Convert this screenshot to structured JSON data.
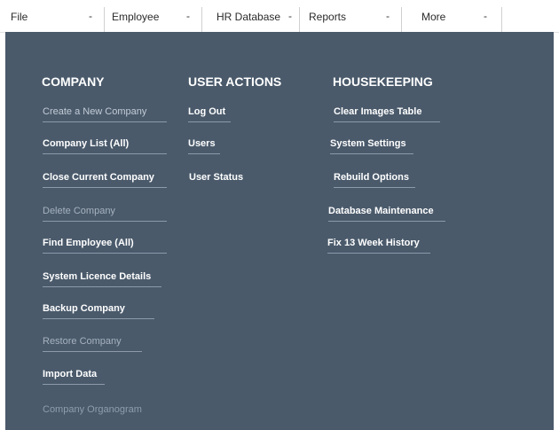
{
  "menubar": {
    "items": [
      {
        "label": "File"
      },
      {
        "label": "Employee"
      },
      {
        "label": "HR Database"
      },
      {
        "label": "Reports"
      },
      {
        "label": "More"
      }
    ],
    "caret": "-"
  },
  "company": {
    "heading": "COMPANY",
    "links": [
      "Create a New Company",
      "Company List (All)",
      "Close Current Company",
      "Delete Company",
      "Find Employee (All)",
      "System Licence Details",
      "Backup Company",
      "Restore Company",
      "Import Data",
      "Company Organogram"
    ]
  },
  "user_actions": {
    "heading": "USER ACTIONS",
    "links": [
      "Log Out",
      "Users",
      "User Status"
    ]
  },
  "housekeeping": {
    "heading": "HOUSEKEEPING",
    "links": [
      "Clear Images Table",
      "System Settings",
      "Rebuild Options",
      "Database Maintenance",
      "Fix 13 Week History"
    ]
  },
  "colors": {
    "panel_bg": "#4a5a6b",
    "menubar_bg": "#ffffff",
    "text_light": "#ffffff"
  }
}
